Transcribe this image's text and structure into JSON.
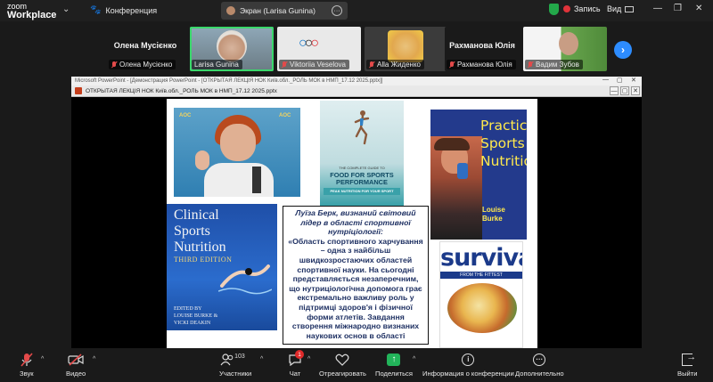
{
  "topbar": {
    "logo_line1": "zoom",
    "logo_line2": "Workplace",
    "conference_label": "Конференция",
    "screen_tab_label": "Экран (Larisa Gunina)",
    "screen_tab_more": "···",
    "record_label": "Запись",
    "view_label": "Вид"
  },
  "participants": [
    {
      "tile_name": "Олена Мусієнко",
      "label": "Олена Мусієнко",
      "video": false
    },
    {
      "tile_name": "",
      "label": "Larisa Gunina",
      "video": true,
      "active": true
    },
    {
      "tile_name": "",
      "label": "Viktoriia Veselova",
      "video": true
    },
    {
      "tile_name": "",
      "label": "Alla Жиденко",
      "video": true
    },
    {
      "tile_name": "Рахманова Юлія",
      "label": "Рахманова Юлія",
      "video": false
    },
    {
      "tile_name": "",
      "label": "Вадим Зубов",
      "video": true
    }
  ],
  "share": {
    "window_title": "Microsoft PowerPoint - [Демонстрация PowerPoint - [ОТКРЫТАЯ ЛЕКЦІЯ НОК Київ.обл._РОЛЬ МОК в НМП_17.12 2025.pptx]]",
    "file_title": "ОТКРЫТАЯ ЛЕКЦІЯ НОК Київ.обл._РОЛЬ МОК в НМП_17.12 2025.pptx"
  },
  "slide": {
    "food_book_line1": "THE COMPLETE GUIDE TO",
    "food_book_line2": "FOOD FOR SPORTS",
    "food_book_line3": "PERFORMANCE",
    "food_book_line4": "PEAK NUTRITION FOR YOUR SPORT",
    "practical_line1": "Practical",
    "practical_line2": "Sports",
    "practical_line3": "Nutrition",
    "practical_author1": "Louise",
    "practical_author2": "Burke",
    "clinical_line1": "Clinical",
    "clinical_line2": "Sports",
    "clinical_line3": "Nutrition",
    "clinical_edition": "THIRD EDITION",
    "clinical_editors1": "EDITED BY",
    "clinical_editors2": "LOUISE BURKE &",
    "clinical_editors3": "VICKI DEAKIN",
    "survival_title": "survival",
    "survival_sub": "FROM THE FITTEST",
    "quote_head": "Луїза Берк, визнаний світовий лідер в області спортивної нутріціології:",
    "quote_body": "«Область спортивного харчування – одна з найбільш швидкозростаючих областей спортивної науки. На сьогодні представляється незаперечним, що нутриціологічна допомога грає екстремально важливу роль у підтримці здоров'я і фізичної форми атлетів. Завдання створення міжнародно визнаних наукових основ в області"
  },
  "toolbar": {
    "audio_label": "Звук",
    "video_label": "Видео",
    "participants_label": "Участники",
    "participants_count": "103",
    "chat_label": "Чат",
    "chat_badge": "1",
    "react_label": "Отреагировать",
    "share_label": "Поделиться",
    "info_label": "Информация о конференции",
    "more_label": "Дополнительно",
    "leave_label": "Выйти"
  }
}
